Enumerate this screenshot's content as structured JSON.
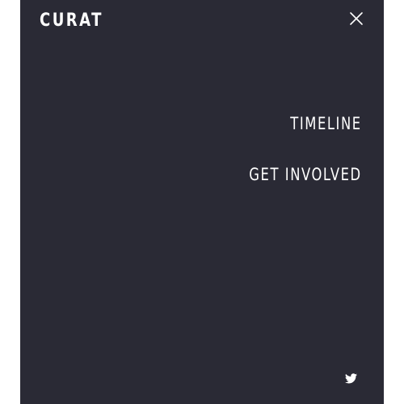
{
  "brand": {
    "name": "CURAT"
  },
  "menu": {
    "close_icon": "close-icon",
    "items": [
      {
        "label": "TIMELINE"
      },
      {
        "label": "GET INVOLVED"
      }
    ]
  },
  "social": {
    "icon": "twitter-icon"
  },
  "colors": {
    "panel_background": "#2a2a35",
    "text": "#ffffff",
    "page_background": "#ffffff"
  }
}
